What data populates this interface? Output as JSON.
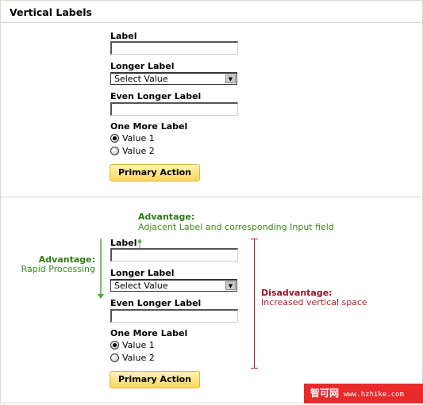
{
  "title": "Vertical Labels",
  "form": {
    "label1": "Label",
    "label2": "Longer Label",
    "select_value": "Select Value",
    "label3": "Even Longer Label",
    "label4": "One More Label",
    "radio1": "Value 1",
    "radio2": "Value 2",
    "radio_selected": "Value 1",
    "button": "Primary Action"
  },
  "annotations": {
    "top_title": "Advantage:",
    "top_text": "Adjacent Label and corresponding Input field",
    "left_title": "Advantage:",
    "left_text": "Rapid Processing",
    "right_title": "Disadvantage:",
    "right_text": "Increased vertical space"
  },
  "colors": {
    "advantage": "#3a8a1e",
    "disadvantage": "#b01a2a",
    "button": "#fcd75a"
  },
  "watermark": {
    "cn": "智可网",
    "url": "www.hzhike.com"
  }
}
